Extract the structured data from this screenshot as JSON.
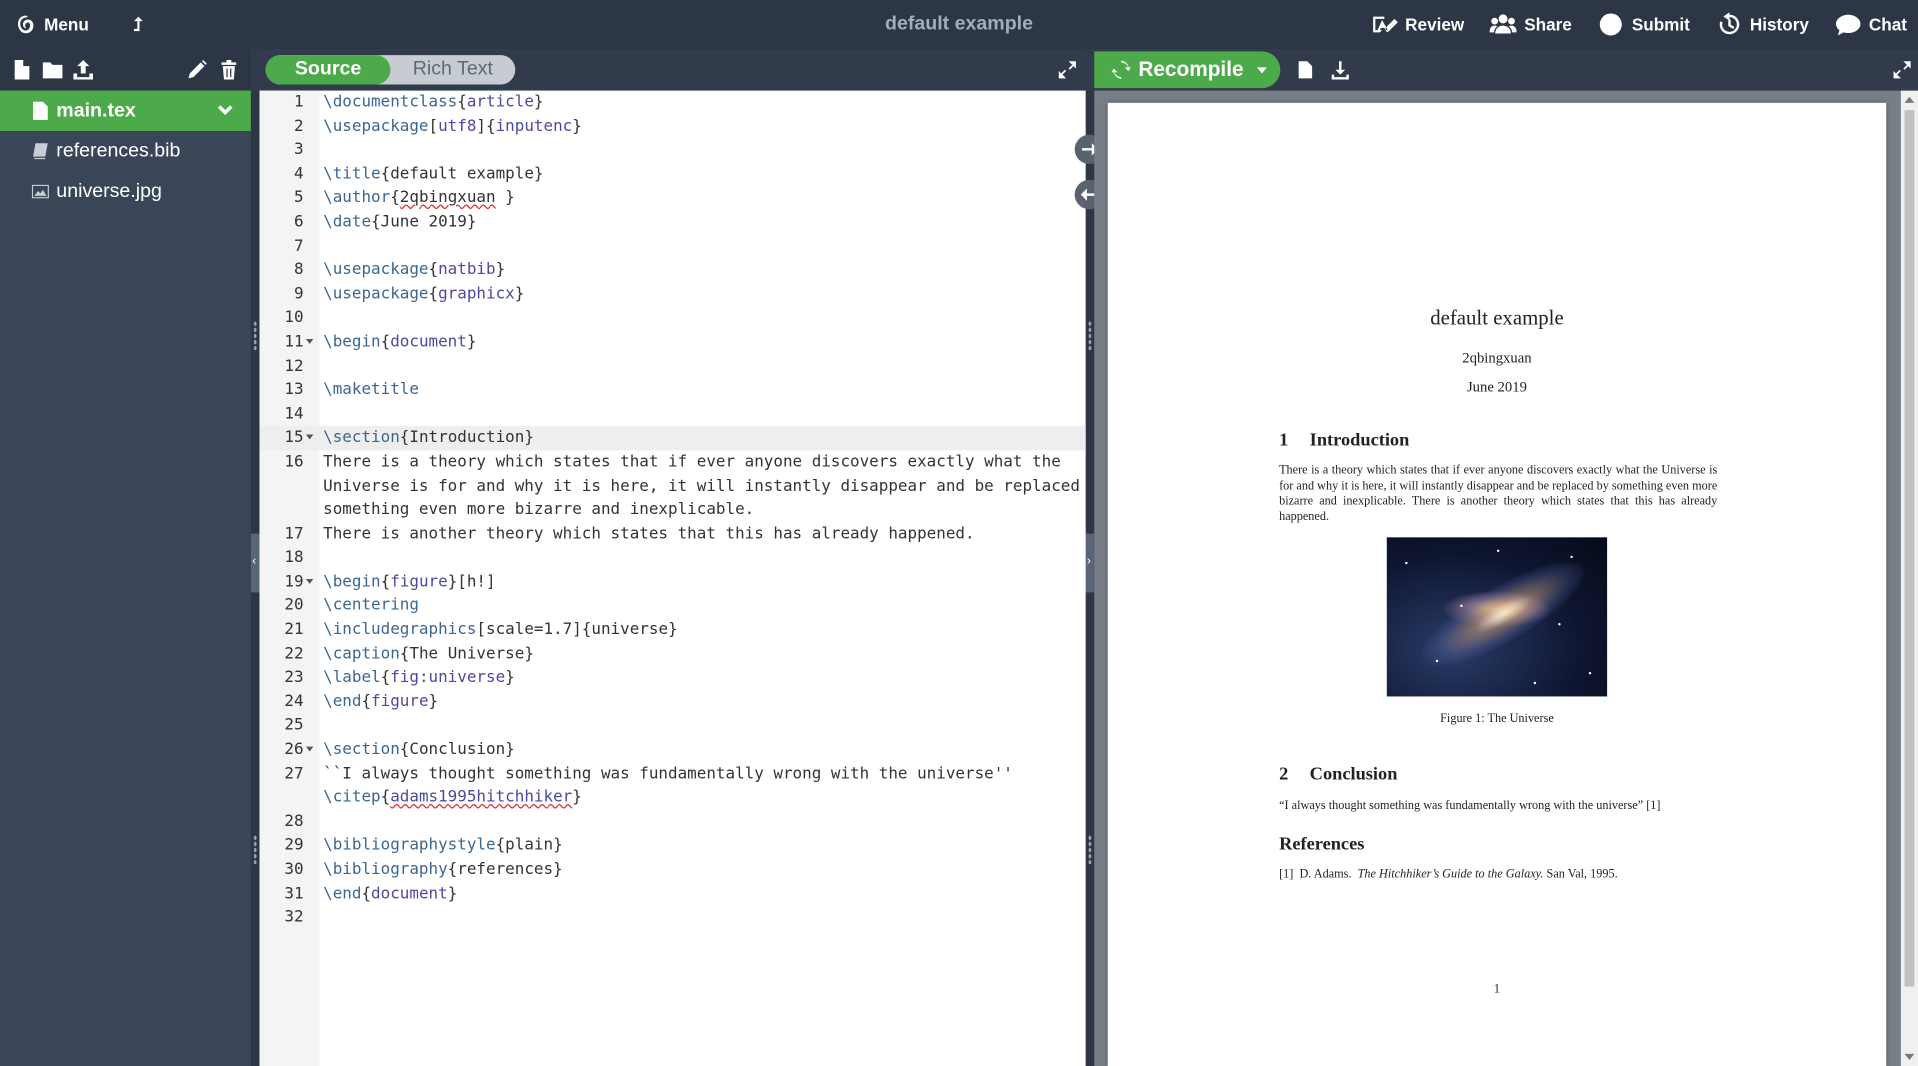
{
  "topbar": {
    "menu_label": "Menu",
    "doc_title": "default example",
    "review_label": "Review",
    "share_label": "Share",
    "submit_label": "Submit",
    "history_label": "History",
    "chat_label": "Chat"
  },
  "editor_toolbar": {
    "source_label": "Source",
    "rich_text_label": "Rich Text"
  },
  "pdf_toolbar": {
    "recompile_label": "Recompile"
  },
  "files": [
    {
      "name": "main.tex",
      "icon": "file-icon"
    },
    {
      "name": "references.bib",
      "icon": "book-icon"
    },
    {
      "name": "universe.jpg",
      "icon": "image-icon"
    }
  ],
  "code_lines": [
    "1",
    "2",
    "3",
    "4",
    "5",
    "6",
    "7",
    "8",
    "9",
    "10",
    "11",
    "12",
    "13",
    "14",
    "15",
    "16",
    "17",
    "18",
    "19",
    "20",
    "21",
    "22",
    "23",
    "24",
    "25",
    "26",
    "27",
    "28",
    "29",
    "30",
    "31",
    "32"
  ],
  "code": {
    "l1": [
      "\\documentclass",
      "{",
      "article",
      "}"
    ],
    "l2": [
      "\\usepackage",
      "[",
      "utf8",
      "]{",
      "inputenc",
      "}"
    ],
    "l4": [
      "\\title",
      "{default example}"
    ],
    "l5": [
      "\\author",
      "{",
      "2qbingxuan",
      " }"
    ],
    "l6": [
      "\\date",
      "{June 2019}"
    ],
    "l8": [
      "\\usepackage",
      "{",
      "natbib",
      "}"
    ],
    "l9": [
      "\\usepackage",
      "{",
      "graphicx",
      "}"
    ],
    "l11": [
      "\\begin",
      "{",
      "document",
      "}"
    ],
    "l13": [
      "\\maketitle"
    ],
    "l15": [
      "\\section",
      "{Introduction}"
    ],
    "l16a": "There is a theory which states that if ever anyone discovers exactly what the",
    "l16b": "Universe is for and why it is here, it will instantly disappear and be replaced by",
    "l16c": "something even more bizarre and inexplicable.",
    "l17": "There is another theory which states that this has already happened.",
    "l19": [
      "\\begin",
      "{",
      "figure",
      "}[h!]"
    ],
    "l20": [
      "\\centering"
    ],
    "l21": [
      "\\includegraphics",
      "[scale=1.7]{universe}"
    ],
    "l22": [
      "\\caption",
      "{The Universe}"
    ],
    "l23": [
      "\\label",
      "{",
      "fig:universe",
      "}"
    ],
    "l24": [
      "\\end",
      "{",
      "figure",
      "}"
    ],
    "l26": [
      "\\section",
      "{Conclusion}"
    ],
    "l27a": "``I always thought something was fundamentally wrong with the universe''",
    "l27b": [
      "\\citep",
      "{",
      "adams1995hitchhiker",
      "}"
    ],
    "l29": [
      "\\bibliographystyle",
      "{plain}"
    ],
    "l30": [
      "\\bibliography",
      "{references}"
    ],
    "l31": [
      "\\end",
      "{",
      "document",
      "}"
    ]
  },
  "pdf": {
    "title": "default example",
    "author": "2qbingxuan",
    "date": "June 2019",
    "sec1_num": "1",
    "sec1_title": "Introduction",
    "sec1_body": "There is a theory which states that if ever anyone discovers exactly what the Universe is for and why it is here, it will instantly disappear and be replaced by something even more bizarre and inexplicable. There is another theory which states that this has already happened.",
    "figure_caption": "Figure 1: The Universe",
    "sec2_num": "2",
    "sec2_title": "Conclusion",
    "sec2_body": "“I always thought something was fundamentally wrong with the universe” [1]",
    "refs_title": "References",
    "ref1_prefix": "[1]  D. Adams.  ",
    "ref1_title": "The Hitchhiker’s Guide to the Galaxy.",
    "ref1_suffix": " San Val, 1995.",
    "page_number": "1"
  }
}
